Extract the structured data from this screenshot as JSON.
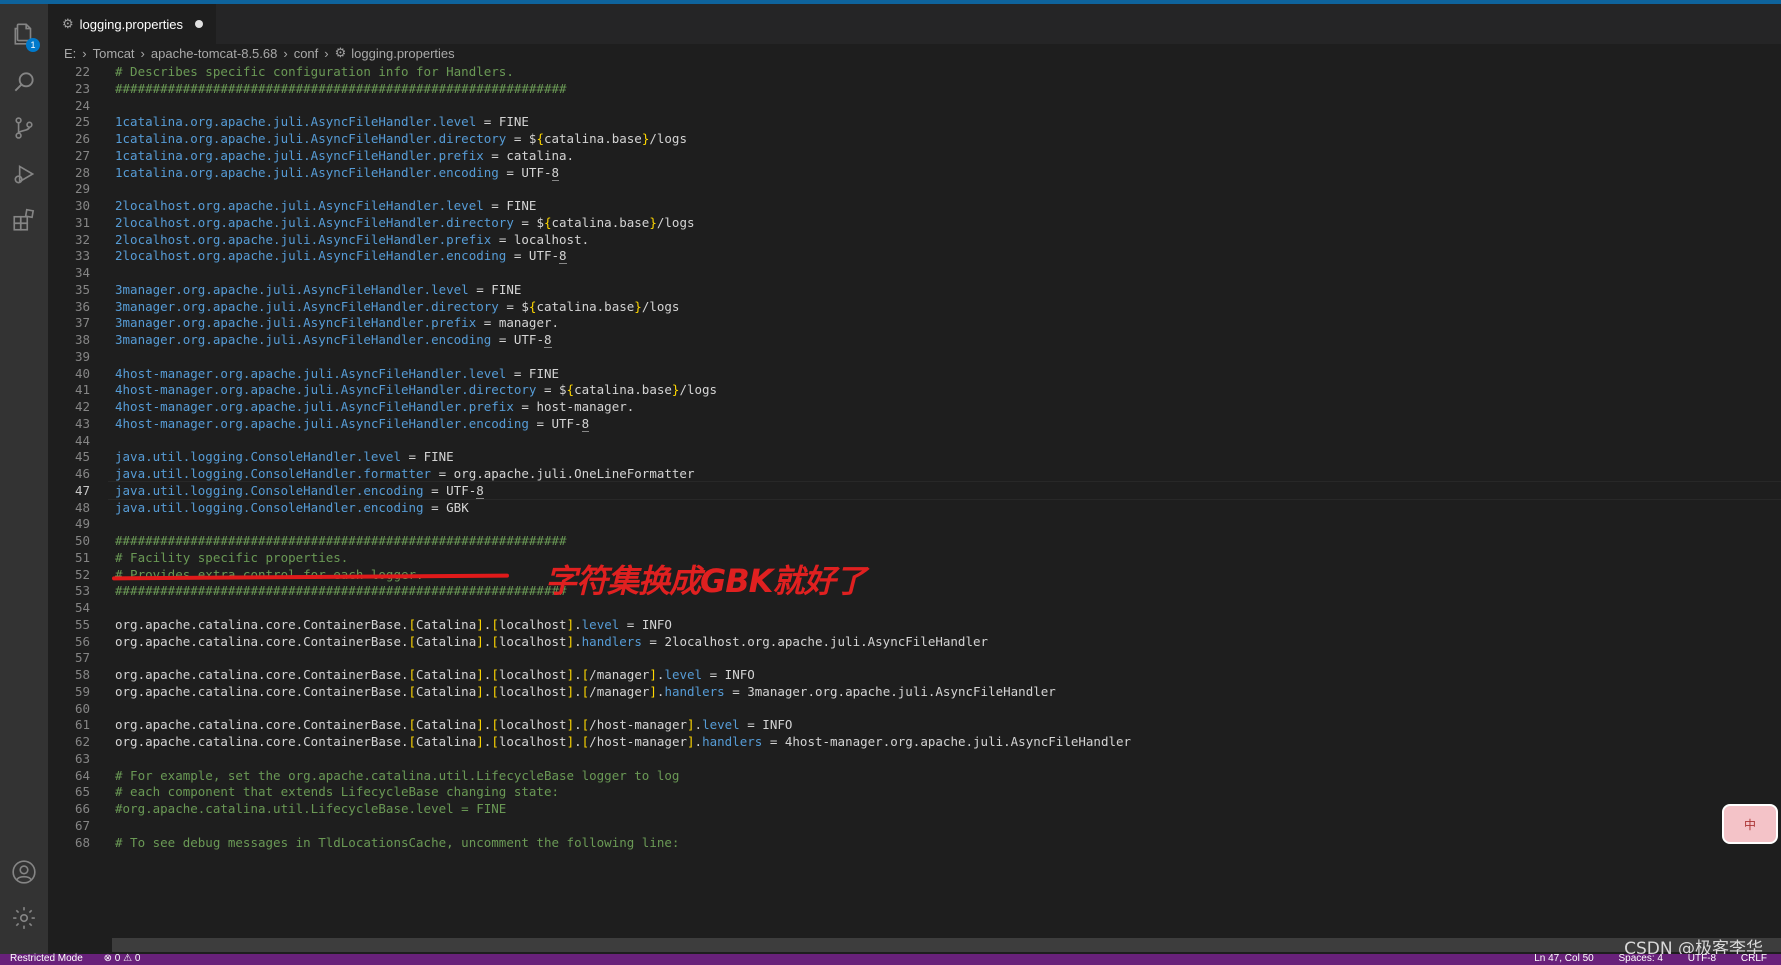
{
  "activity": {
    "explorer_badge": "1"
  },
  "tab": {
    "filename": "logging.properties"
  },
  "breadcrumb": [
    "E:",
    "Tomcat",
    "apache-tomcat-8.5.68",
    "conf",
    "logging.properties"
  ],
  "annotation": "字符集换成GBK就好了",
  "ime_label": "中",
  "watermark": "CSDN @极客李华",
  "status": {
    "restricted": "Restricted Mode",
    "problems": "⊗ 0  ⚠ 0",
    "position": "Ln 47, Col 50",
    "spaces": "Spaces: 4",
    "encoding": "UTF-8",
    "eol": "CRLF"
  },
  "editor": {
    "current_line": "47",
    "lines": [
      {
        "n": "22",
        "t": "# Describes specific configuration info for Handlers."
      },
      {
        "n": "23",
        "t": "############################################################"
      },
      {
        "n": "24",
        "t": ""
      },
      {
        "n": "25",
        "t": "1catalina.org.apache.juli.AsyncFileHandler.level = FINE"
      },
      {
        "n": "26",
        "t": "1catalina.org.apache.juli.AsyncFileHandler.directory = ${catalina.base}/logs"
      },
      {
        "n": "27",
        "t": "1catalina.org.apache.juli.AsyncFileHandler.prefix = catalina."
      },
      {
        "n": "28",
        "t": "1catalina.org.apache.juli.AsyncFileHandler.encoding = UTF-8"
      },
      {
        "n": "29",
        "t": ""
      },
      {
        "n": "30",
        "t": "2localhost.org.apache.juli.AsyncFileHandler.level = FINE"
      },
      {
        "n": "31",
        "t": "2localhost.org.apache.juli.AsyncFileHandler.directory = ${catalina.base}/logs"
      },
      {
        "n": "32",
        "t": "2localhost.org.apache.juli.AsyncFileHandler.prefix = localhost."
      },
      {
        "n": "33",
        "t": "2localhost.org.apache.juli.AsyncFileHandler.encoding = UTF-8"
      },
      {
        "n": "34",
        "t": ""
      },
      {
        "n": "35",
        "t": "3manager.org.apache.juli.AsyncFileHandler.level = FINE"
      },
      {
        "n": "36",
        "t": "3manager.org.apache.juli.AsyncFileHandler.directory = ${catalina.base}/logs"
      },
      {
        "n": "37",
        "t": "3manager.org.apache.juli.AsyncFileHandler.prefix = manager."
      },
      {
        "n": "38",
        "t": "3manager.org.apache.juli.AsyncFileHandler.encoding = UTF-8"
      },
      {
        "n": "39",
        "t": ""
      },
      {
        "n": "40",
        "t": "4host-manager.org.apache.juli.AsyncFileHandler.level = FINE"
      },
      {
        "n": "41",
        "t": "4host-manager.org.apache.juli.AsyncFileHandler.directory = ${catalina.base}/logs"
      },
      {
        "n": "42",
        "t": "4host-manager.org.apache.juli.AsyncFileHandler.prefix = host-manager."
      },
      {
        "n": "43",
        "t": "4host-manager.org.apache.juli.AsyncFileHandler.encoding = UTF-8"
      },
      {
        "n": "44",
        "t": ""
      },
      {
        "n": "45",
        "t": "java.util.logging.ConsoleHandler.level = FINE"
      },
      {
        "n": "46",
        "t": "java.util.logging.ConsoleHandler.formatter = org.apache.juli.OneLineFormatter"
      },
      {
        "n": "47",
        "t": "java.util.logging.ConsoleHandler.encoding = UTF-8"
      },
      {
        "n": "48",
        "t": "java.util.logging.ConsoleHandler.encoding = GBK"
      },
      {
        "n": "49",
        "t": ""
      },
      {
        "n": "50",
        "t": "############################################################"
      },
      {
        "n": "51",
        "t": "# Facility specific properties."
      },
      {
        "n": "52",
        "t": "# Provides extra control for each logger."
      },
      {
        "n": "53",
        "t": "############################################################"
      },
      {
        "n": "54",
        "t": ""
      },
      {
        "n": "55",
        "t": "org.apache.catalina.core.ContainerBase.[Catalina].[localhost].level = INFO"
      },
      {
        "n": "56",
        "t": "org.apache.catalina.core.ContainerBase.[Catalina].[localhost].handlers = 2localhost.org.apache.juli.AsyncFileHandler"
      },
      {
        "n": "57",
        "t": ""
      },
      {
        "n": "58",
        "t": "org.apache.catalina.core.ContainerBase.[Catalina].[localhost].[/manager].level = INFO"
      },
      {
        "n": "59",
        "t": "org.apache.catalina.core.ContainerBase.[Catalina].[localhost].[/manager].handlers = 3manager.org.apache.juli.AsyncFileHandler"
      },
      {
        "n": "60",
        "t": ""
      },
      {
        "n": "61",
        "t": "org.apache.catalina.core.ContainerBase.[Catalina].[localhost].[/host-manager].level = INFO"
      },
      {
        "n": "62",
        "t": "org.apache.catalina.core.ContainerBase.[Catalina].[localhost].[/host-manager].handlers = 4host-manager.org.apache.juli.AsyncFileHandler"
      },
      {
        "n": "63",
        "t": ""
      },
      {
        "n": "64",
        "t": "# For example, set the org.apache.catalina.util.LifecycleBase logger to log"
      },
      {
        "n": "65",
        "t": "# each component that extends LifecycleBase changing state:"
      },
      {
        "n": "66",
        "t": "#org.apache.catalina.util.LifecycleBase.level = FINE"
      },
      {
        "n": "67",
        "t": ""
      },
      {
        "n": "68",
        "t": "# To see debug messages in TldLocationsCache, uncomment the following line:"
      }
    ]
  },
  "colors": {
    "keyword": "#569cd6",
    "comment": "#6a9955",
    "bracket": "#ffd700",
    "text": "#d4d4d4",
    "status_bar": "#68217a",
    "annotation": "#e02020"
  }
}
